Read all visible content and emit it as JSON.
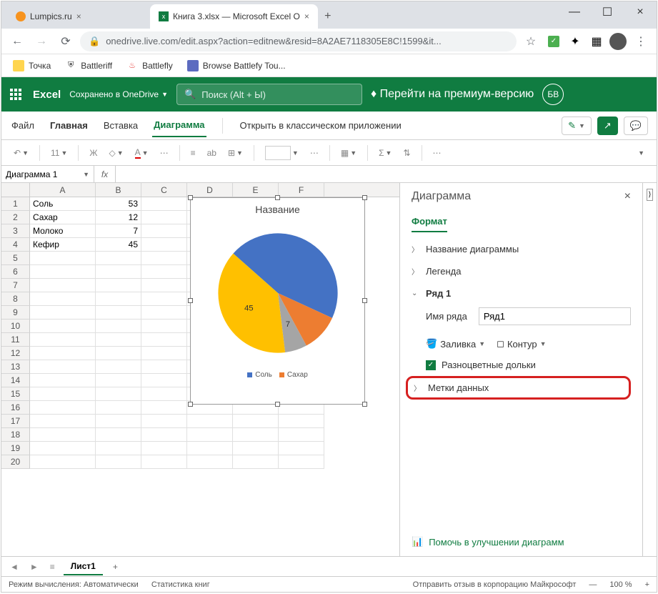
{
  "browser": {
    "tabs": [
      {
        "title": "Lumpics.ru",
        "active": false
      },
      {
        "title": "Книга 3.xlsx — Microsoft Excel O",
        "active": true
      }
    ],
    "url": "onedrive.live.com/edit.aspx?action=editnew&resid=8A2AE7118305E8C!1599&it...",
    "bookmarks": [
      {
        "label": "Точка"
      },
      {
        "label": "Battleriff"
      },
      {
        "label": "Battlefly"
      },
      {
        "label": "Browse Battlefy Tou..."
      }
    ]
  },
  "excel": {
    "app_name": "Excel",
    "save_status": "Сохранено в OneDrive",
    "search_placeholder": "Поиск (Alt + Ы)",
    "premium": "Перейти на премиум-версию",
    "user_initials": "БВ",
    "tabs": {
      "file": "Файл",
      "home": "Главная",
      "insert": "Вставка",
      "chart": "Диаграмма",
      "open_desktop": "Открыть в классическом приложении"
    },
    "ribbon": {
      "font_size": "11",
      "bold": "Ж",
      "font_color": "A",
      "align": "≡",
      "wrap": "ab"
    },
    "namebox": "Диаграмма 1"
  },
  "cells": {
    "rows": [
      {
        "n": 1,
        "a": "Соль",
        "b": "53"
      },
      {
        "n": 2,
        "a": "Сахар",
        "b": "12"
      },
      {
        "n": 3,
        "a": "Молоко",
        "b": "7"
      },
      {
        "n": 4,
        "a": "Кефир",
        "b": "45"
      },
      {
        "n": 5,
        "a": "",
        "b": ""
      },
      {
        "n": 6,
        "a": "",
        "b": ""
      },
      {
        "n": 7,
        "a": "",
        "b": ""
      },
      {
        "n": 8,
        "a": "",
        "b": ""
      },
      {
        "n": 9,
        "a": "",
        "b": ""
      },
      {
        "n": 10,
        "a": "",
        "b": ""
      },
      {
        "n": 11,
        "a": "",
        "b": ""
      },
      {
        "n": 12,
        "a": "",
        "b": ""
      },
      {
        "n": 13,
        "a": "",
        "b": ""
      },
      {
        "n": 14,
        "a": "",
        "b": ""
      },
      {
        "n": 15,
        "a": "",
        "b": ""
      },
      {
        "n": 16,
        "a": "",
        "b": ""
      },
      {
        "n": 17,
        "a": "",
        "b": ""
      },
      {
        "n": 18,
        "a": "",
        "b": ""
      },
      {
        "n": 19,
        "a": "",
        "b": ""
      },
      {
        "n": 20,
        "a": "",
        "b": ""
      }
    ],
    "cols": [
      "A",
      "B",
      "C",
      "D",
      "E",
      "F"
    ]
  },
  "chart_data": {
    "type": "pie",
    "title": "Название",
    "categories": [
      "Соль",
      "Сахар",
      "Молоко",
      "Кефир"
    ],
    "values": [
      53,
      12,
      7,
      45
    ],
    "colors": [
      "#4472c4",
      "#ed7d31",
      "#a5a5a5",
      "#ffc000"
    ],
    "labels_shown": [
      "45",
      "7"
    ],
    "legend": [
      "Соль",
      "Сахар"
    ]
  },
  "sidepane": {
    "title": "Диаграмма",
    "tab": "Формат",
    "items": {
      "chart_title": "Название диаграммы",
      "legend": "Легенда",
      "series": "Ряд 1",
      "series_name_label": "Имя ряда",
      "series_name_value": "Ряд1",
      "fill": "Заливка",
      "outline": "Контур",
      "varycolors": "Разноцветные дольки",
      "data_labels": "Метки данных"
    },
    "footer": "Помочь в улучшении диаграмм"
  },
  "sheets": {
    "name": "Лист1"
  },
  "status": {
    "calc": "Режим вычисления: Автоматически",
    "stats": "Статистика книг",
    "feedback": "Отправить отзыв в корпорацию Майкрософт",
    "zoom": "100 %"
  }
}
